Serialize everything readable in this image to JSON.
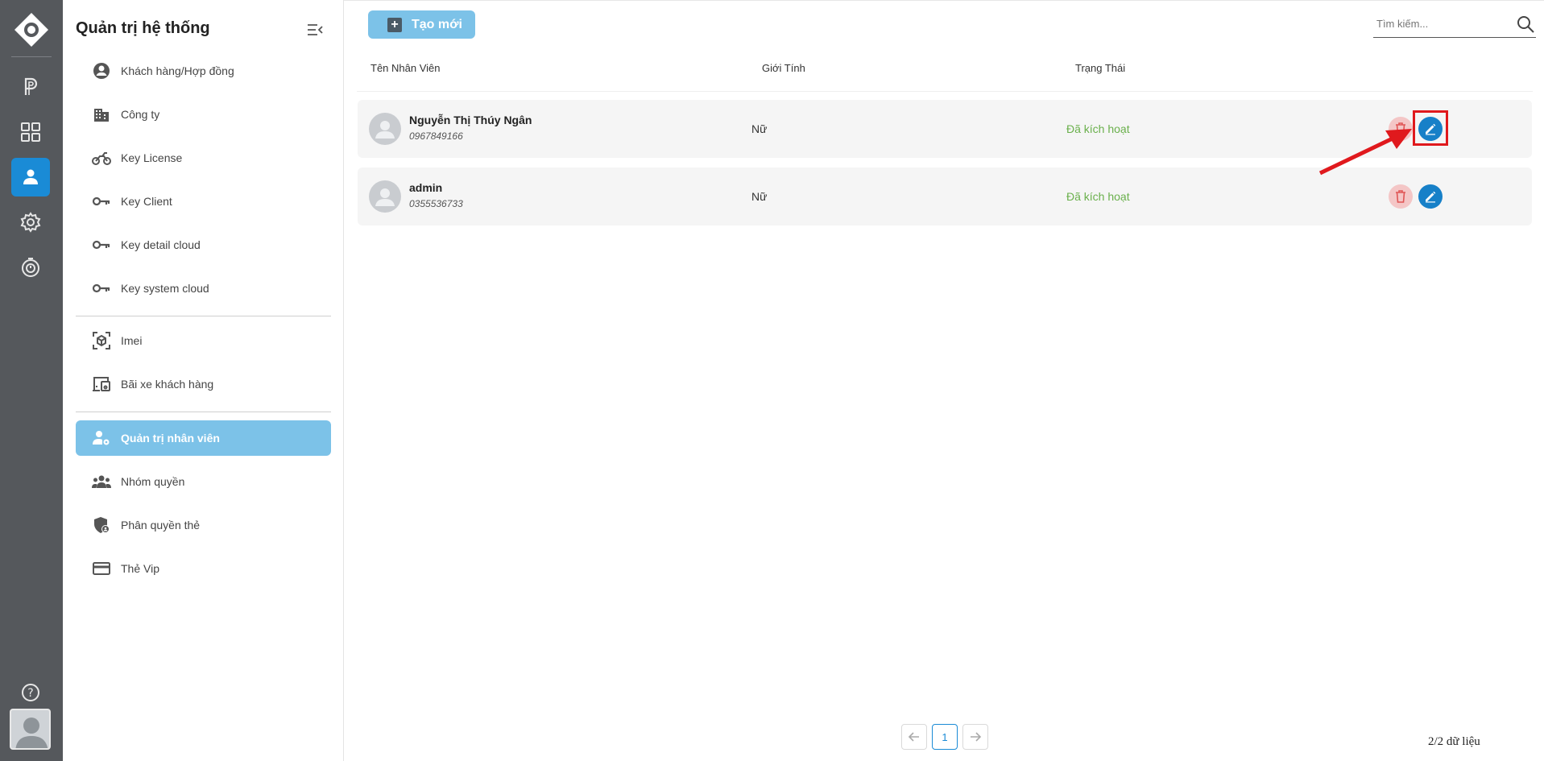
{
  "sidebar": {
    "title": "Quản trị hệ thống",
    "items": [
      {
        "label": "Khách hàng/Hợp đồng"
      },
      {
        "label": "Công ty"
      },
      {
        "label": "Key License"
      },
      {
        "label": "Key Client"
      },
      {
        "label": "Key detail cloud"
      },
      {
        "label": "Key system cloud"
      },
      {
        "label": "Imei"
      },
      {
        "label": "Bãi xe khách hàng"
      },
      {
        "label": "Quản trị nhân viên",
        "active": true
      },
      {
        "label": "Nhóm quyền"
      },
      {
        "label": "Phân quyền thẻ"
      },
      {
        "label": "Thẻ Vip"
      }
    ]
  },
  "toolbar": {
    "new_label": "Tạo mới",
    "search_placeholder": "Tìm kiếm..."
  },
  "table": {
    "headers": [
      "Tên Nhân Viên",
      "Giới Tính",
      "Trạng Thái"
    ],
    "rows": [
      {
        "name": "Nguyễn Thị Thúy Ngân",
        "phone": "0967849166",
        "gender": "Nữ",
        "status": "Đã kích hoạt"
      },
      {
        "name": "admin",
        "phone": "0355536733",
        "gender": "Nữ",
        "status": "Đã kích hoạt"
      }
    ]
  },
  "pagination": {
    "current_page": "1",
    "summary": "2/2 dữ liệu"
  },
  "colors": {
    "rail": "#55585c",
    "accent": "#1a8bd6",
    "active_item": "#7cc2e8",
    "status_active": "#6ab04c",
    "delete_bg": "#f4c6c6",
    "edit_bg": "#1780c8",
    "annotation": "#e0191d"
  }
}
